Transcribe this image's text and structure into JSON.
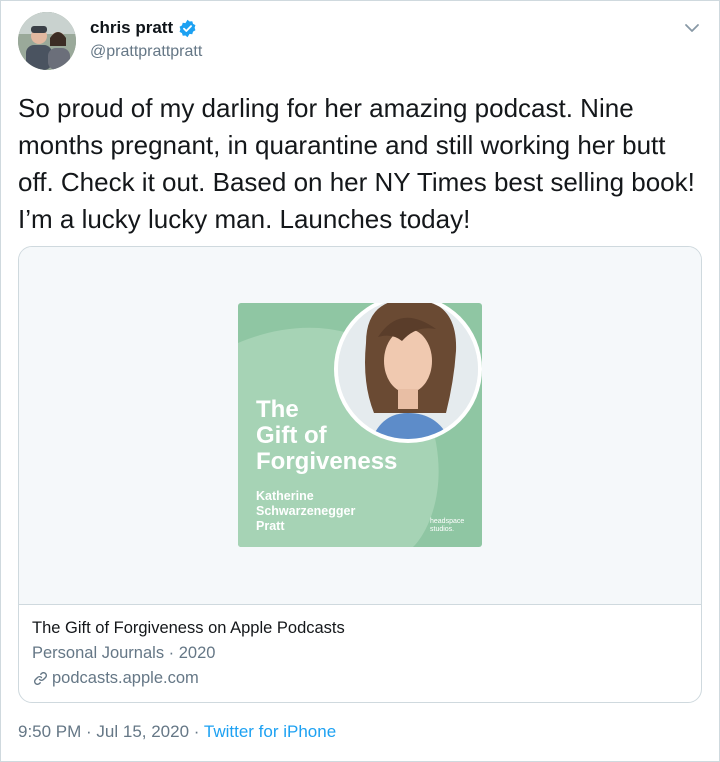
{
  "user": {
    "display_name": "chris pratt",
    "handle": "@prattprattpratt",
    "verified_icon": "verified-badge-icon",
    "caret_icon": "chevron-down-icon"
  },
  "tweet": {
    "text": "So proud of my darling for her amazing podcast. Nine months pregnant, in quarantine and still working her butt off. Check it out. Based on her NY Times best selling book! I’m a lucky lucky man. Launches today!"
  },
  "card": {
    "artwork": {
      "title_lines": [
        "The",
        "Gift of",
        "Forgiveness"
      ],
      "author_lines": [
        "Katherine",
        "Schwarzenegger",
        "Pratt"
      ],
      "brand_lines": [
        "headspace",
        "studios."
      ]
    },
    "title": "The Gift of Forgiveness on Apple Podcasts",
    "subtitle": "Personal Journals · 2020",
    "domain": "podcasts.apple.com",
    "link_icon": "link-icon"
  },
  "meta": {
    "time": "9:50 PM",
    "sep1": " · ",
    "date": "Jul 15, 2020",
    "sep2": " · ",
    "source": "Twitter for iPhone"
  },
  "colors": {
    "accent": "#1da1f2",
    "artwork_bg": "#8fc6a3",
    "artwork_light": "#a6d3b5",
    "muted": "#657786"
  }
}
